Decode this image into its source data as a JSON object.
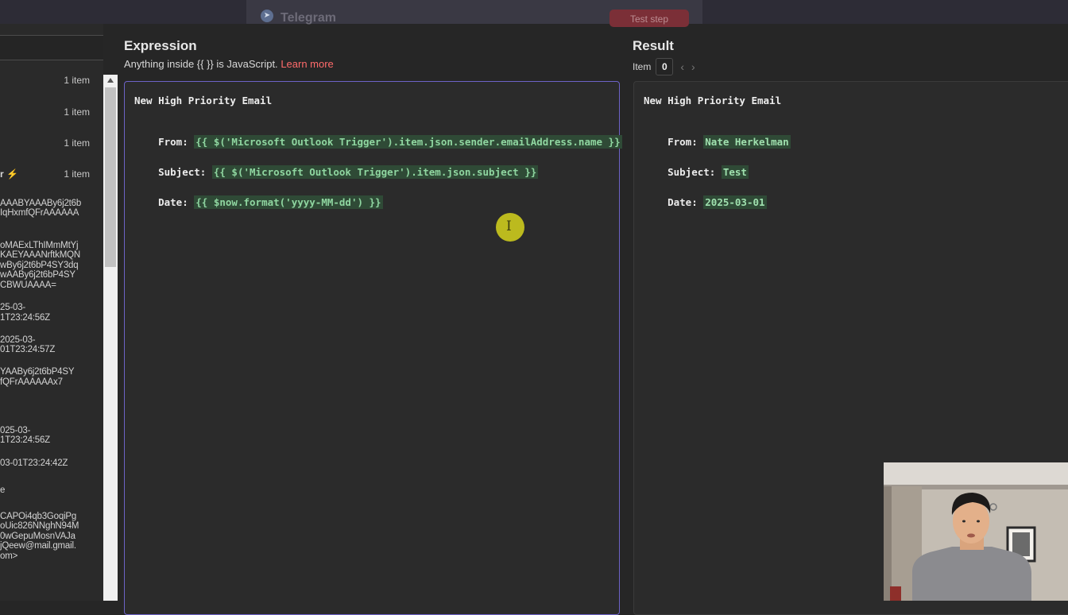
{
  "topbar": {
    "node_title": "Telegram",
    "test_button_label": "Test step"
  },
  "left_panel": {
    "item_counts": [
      "1 item",
      "1 item",
      "1 item",
      "1 item"
    ],
    "partial_node_name": "r",
    "value_lines": [
      "AAABYAAABy6j2t6b",
      "IqHxmfQFrAAAAAA",
      "oMAExLThIMmMtYj",
      "KAEYAAANrftkMQN",
      "wBy6j2t6bP4SY3dq",
      "wAABy6j2t6bP4SY",
      "CBWUAAAA=",
      "25-03-",
      "1T23:24:56Z",
      "2025-03-",
      "01T23:24:57Z",
      "YAABy6j2t6bP4SY",
      "fQFrAAAAAAx7",
      "025-03-",
      "1T23:24:56Z",
      "03-01T23:24:42Z",
      "e",
      "CAPOi4qb3GoqiPg",
      "oUic826NNghN94M",
      "0wGepuMosnVAJa",
      "jQeew@mail.gmail.",
      "om>"
    ]
  },
  "expression": {
    "title": "Expression",
    "hint_prefix": "Anything inside {{  }} is JavaScript.",
    "learn_more": "Learn more",
    "heading": "New High Priority Email",
    "from_label": "From:",
    "from_expr": "{{ $('Microsoft Outlook Trigger').item.json.sender.emailAddress.name }}",
    "subject_label": "Subject:",
    "subject_expr": "{{ $('Microsoft Outlook Trigger').item.json.subject }}",
    "date_label": "Date:",
    "date_expr": "{{ $now.format('yyyy-MM-dd') }}"
  },
  "result": {
    "title": "Result",
    "item_label": "Item",
    "item_index": "0",
    "prev_icon": "chevron-left-icon",
    "next_icon": "chevron-right-icon",
    "heading": "New High Priority Email",
    "from_label": "From:",
    "from_value": "Nate Herkelman",
    "subject_label": "Subject:",
    "subject_value": "Test",
    "date_label": "Date:",
    "date_value": "2025-03-01"
  },
  "colors": {
    "background": "#262626",
    "editor_border": "#6d63c7",
    "highlight_bg": "#2f4a36",
    "highlight_text": "#8fd6a0",
    "link": "#ff6b6b",
    "cursor": "#c9c71d"
  }
}
